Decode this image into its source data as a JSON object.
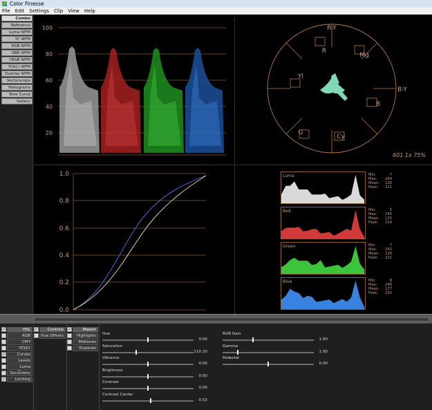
{
  "window": {
    "title": "Color Finesse"
  },
  "menu": [
    "File",
    "Edit",
    "Settings",
    "Clip",
    "View",
    "Help"
  ],
  "scope_buttons": [
    "Combo",
    "Reference",
    "Luma WFM",
    "YC WFM",
    "RGB WFM",
    "GBR WFM",
    "YRGB WFM",
    "YCbCr WFM",
    "Overlay WFM",
    "Vectorscope",
    "Histograms",
    "Tone Curve",
    "Gallery"
  ],
  "waveform": {
    "ticks": [
      "100",
      "80",
      "60",
      "40",
      "20"
    ]
  },
  "vectorscope": {
    "targets": [
      "R-Y",
      "R",
      "Mg",
      "B-Y",
      "B",
      "Cy",
      "G",
      "Yl"
    ],
    "readout": "601.1x 75%"
  },
  "tone_curve": {
    "ticks": [
      "1.0",
      "0.8",
      "0.6",
      "0.4",
      "0.2",
      "0.0"
    ]
  },
  "histograms": [
    {
      "name": "Luma",
      "min": "7",
      "max": "244",
      "mean": "126",
      "peak": "221",
      "color": "#d9d9d9"
    },
    {
      "name": "Red",
      "min": "5",
      "max": "245",
      "mean": "125",
      "peak": "214",
      "color": "#d23a3a"
    },
    {
      "name": "Green",
      "min": "7",
      "max": "243",
      "mean": "128",
      "peak": "221",
      "color": "#3cc43c"
    },
    {
      "name": "Blue",
      "min": "8",
      "max": "248",
      "mean": "127",
      "peak": "235",
      "color": "#3a82e0"
    }
  ],
  "stat_labels": {
    "min": "Min:",
    "max": "Max:",
    "mean": "Mean:",
    "peak": "Peak:"
  },
  "panel_list": [
    {
      "label": "HSL",
      "checked": true,
      "active": true
    },
    {
      "label": "RGB",
      "checked": false,
      "active": false
    },
    {
      "label": "CMY",
      "checked": false,
      "active": false
    },
    {
      "label": "YCbCr",
      "checked": false,
      "active": false
    },
    {
      "label": "Curves",
      "checked": true,
      "active": false
    },
    {
      "label": "Levels",
      "checked": false,
      "active": false
    },
    {
      "label": "Luma Range",
      "checked": false,
      "active": false
    },
    {
      "label": "Secondary",
      "checked": false,
      "active": false
    },
    {
      "label": "Limiting",
      "checked": true,
      "active": false
    }
  ],
  "controls_list": [
    {
      "label": "Controls",
      "checked": true,
      "active": true
    },
    {
      "label": "Hue Offsets",
      "checked": false,
      "active": false
    }
  ],
  "range_list": [
    {
      "label": "Master",
      "checked": true,
      "active": true
    },
    {
      "label": "Highlights",
      "checked": false,
      "active": false
    },
    {
      "label": "Midtones",
      "checked": false,
      "active": false
    },
    {
      "label": "Shadows",
      "checked": false,
      "active": false
    }
  ],
  "params_left": [
    {
      "label": "Hue",
      "value": "0.00",
      "level": 0.5
    },
    {
      "label": "Saturation",
      "value": "110.20",
      "level": 0.37
    },
    {
      "label": "Vibrance",
      "value": "0.00",
      "level": 0.5
    },
    {
      "label": "Brightness",
      "value": "0.00",
      "level": 0.5
    },
    {
      "label": "Contrast",
      "value": "0.00",
      "level": 0.5
    },
    {
      "label": "Contrast Center",
      "value": "0.53",
      "level": 0.53
    }
  ],
  "params_right": [
    {
      "label": "RGB Gain",
      "value": "1.00",
      "level": 0.33
    },
    {
      "label": "Gamma",
      "value": "1.00",
      "level": 0.17
    },
    {
      "label": "Pedestal",
      "value": "0.00",
      "level": 0.5
    }
  ]
}
